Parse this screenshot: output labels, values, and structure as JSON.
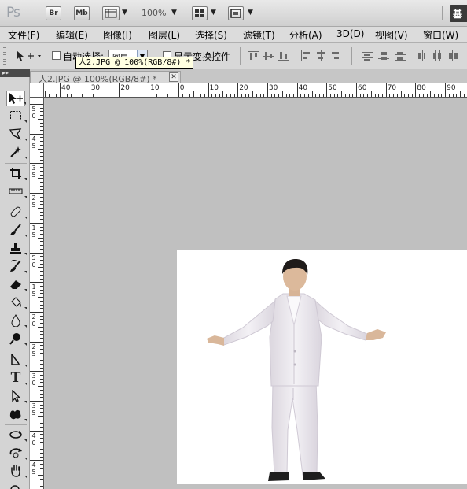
{
  "app": {
    "logo": "Ps",
    "workspace_button": "基"
  },
  "appbar": {
    "bridge_label": "Br",
    "minibridge_label": "Mb",
    "zoom_value": "100%"
  },
  "menu": {
    "items": [
      {
        "label": "文件(F)"
      },
      {
        "label": "编辑(E)"
      },
      {
        "label": "图像(I)"
      },
      {
        "label": "图层(L)"
      },
      {
        "label": "选择(S)"
      },
      {
        "label": "滤镜(T)"
      },
      {
        "label": "分析(A)"
      },
      {
        "label": "3D(D)"
      },
      {
        "label": "视图(V)"
      },
      {
        "label": "窗口(W)"
      }
    ]
  },
  "options": {
    "auto_select_label": "自动选择:",
    "auto_select_value": "图层",
    "show_transform_label": "显示变换控件",
    "tooltip": "人2.JPG @ 100%(RGB/8#) *"
  },
  "document": {
    "tab_title": "人2.JPG @ 100%(RGB/8#) *"
  },
  "ruler": {
    "h_labels": [
      "40",
      "30",
      "20",
      "10",
      "0",
      "10",
      "20",
      "30",
      "40",
      "50",
      "60",
      "70",
      "80",
      "90"
    ],
    "v_labels": [
      "5",
      "0",
      "4",
      "5",
      "3",
      "5",
      "2",
      "5",
      "1",
      "5",
      "5",
      "0",
      "1",
      "5",
      "2",
      "0",
      "2",
      "5",
      "3",
      "0",
      "3",
      "5",
      "4",
      "0",
      "4",
      "5",
      "5",
      "0",
      "5",
      "5",
      "6",
      "0"
    ]
  },
  "icons": {
    "toolbar": [
      "move-tool-icon",
      "marquee-tool-icon",
      "lasso-tool-icon",
      "magic-wand-tool-icon",
      "crop-tool-icon",
      "ruler-tool-icon",
      "healing-brush-tool-icon",
      "brush-tool-icon",
      "clone-stamp-tool-icon",
      "history-brush-tool-icon",
      "eraser-tool-icon",
      "paint-bucket-tool-icon",
      "blur-tool-icon",
      "dodge-tool-icon",
      "pen-tool-icon",
      "type-tool-icon",
      "path-selection-tool-icon",
      "custom-shape-tool-icon",
      "3d-rotate-tool-icon",
      "3d-orbit-tool-icon",
      "hand-tool-icon",
      "zoom-tool-icon"
    ]
  },
  "colors": {
    "canvas_bg": "#ffffff",
    "workspace_bg": "#c0c0c0",
    "suit": "#ece9ef"
  }
}
